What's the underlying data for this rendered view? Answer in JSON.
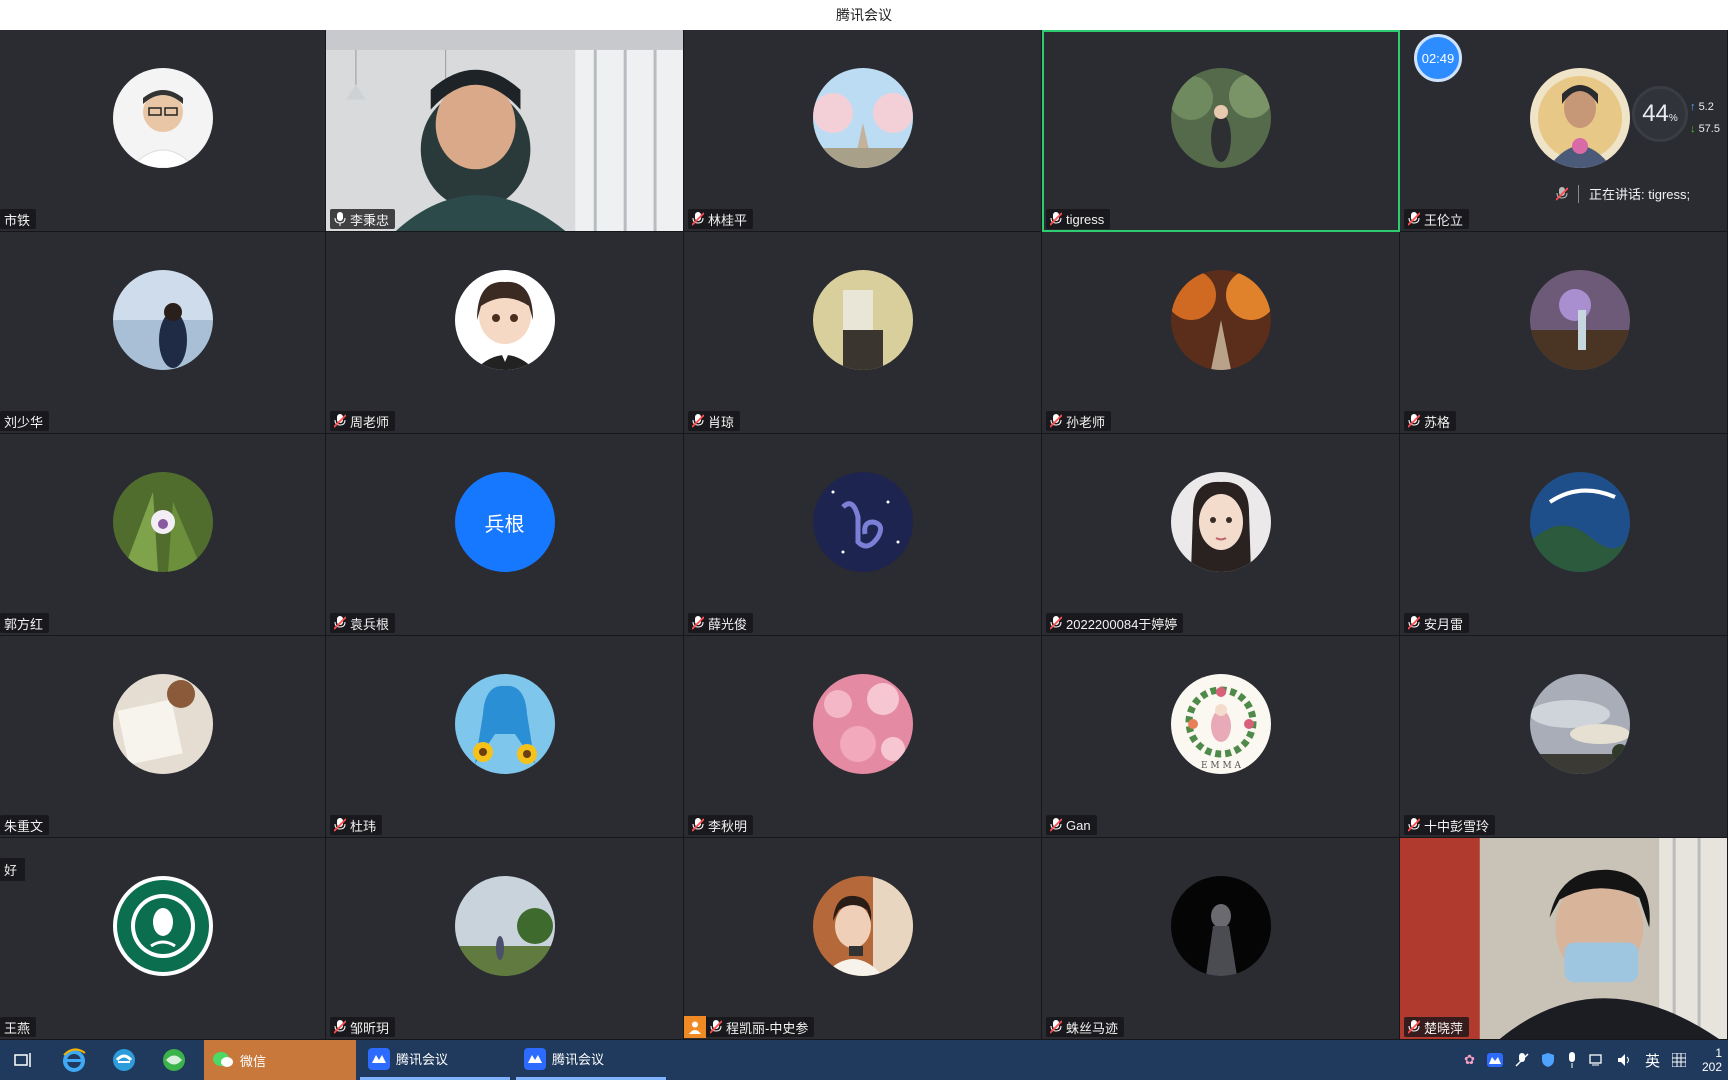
{
  "window": {
    "title": "腾讯会议"
  },
  "overlay": {
    "timer": "02:49",
    "cpu_percent": "44",
    "cpu_unit": "%",
    "upload": "5.2",
    "download": "57.5",
    "speaking_label": "正在讲话: tigress;"
  },
  "participants": [
    {
      "name": "市铁",
      "avatar": "photo-man-glasses"
    },
    {
      "name": "李秉忠",
      "avatar": "video"
    },
    {
      "name": "林桂平",
      "avatar": "photo-blossom-trees"
    },
    {
      "name": "tigress",
      "avatar": "photo-garden-person"
    },
    {
      "name": "王伦立",
      "avatar": "photo-illustration-lotus"
    },
    {
      "name": "刘少华",
      "avatar": "photo-sea-woman"
    },
    {
      "name": "周老师",
      "avatar": "cartoon-girl"
    },
    {
      "name": "肖琼",
      "avatar": "photo-field-bag"
    },
    {
      "name": "孙老师",
      "avatar": "photo-autumn-road"
    },
    {
      "name": "苏格",
      "avatar": "photo-summer-flowers"
    },
    {
      "name": "郭方红",
      "avatar": "photo-orchid"
    },
    {
      "name": "袁兵根",
      "avatar": "text",
      "initials": "兵根"
    },
    {
      "name": "薛光俊",
      "avatar": "capricorn-sign"
    },
    {
      "name": "2022200084于婷婷",
      "avatar": "cartoon-woman"
    },
    {
      "name": "安月雷",
      "avatar": "photo-paraglider"
    },
    {
      "name": "朱重文",
      "avatar": "photo-book-coffee"
    },
    {
      "name": "杜玮",
      "avatar": "anime-sunflowers"
    },
    {
      "name": "李秋明",
      "avatar": "photo-cherry-blossom"
    },
    {
      "name": "Gan",
      "avatar": "emma-wreath"
    },
    {
      "name": "十中彭雪玲",
      "avatar": "photo-sky-clouds"
    },
    {
      "name": "王燕",
      "avatar": "starbucks-logo"
    },
    {
      "name": "邹昕玥",
      "avatar": "photo-tree-girl"
    },
    {
      "name": "程凯丽-中史参",
      "avatar": "photo-girl-phone"
    },
    {
      "name": "蛛丝马迹",
      "avatar": "photo-dark-figure"
    },
    {
      "name": "楚晓萍",
      "avatar": "video"
    }
  ],
  "corner_tag": "好",
  "taskbar": {
    "apps": [
      {
        "label": "微信",
        "active": true
      },
      {
        "label": "腾讯会议",
        "active": false
      },
      {
        "label": "腾讯会议",
        "active": false
      }
    ],
    "ime": "英",
    "clock_partial_1": "1",
    "clock_partial_2": "202"
  },
  "colors": {
    "tile_bg": "#2a2c31",
    "active_border": "#2ecc71",
    "accent_blue": "#1677ff",
    "taskbar_bg": "#1f3a5c",
    "wechat_tab": "#c8783a"
  }
}
